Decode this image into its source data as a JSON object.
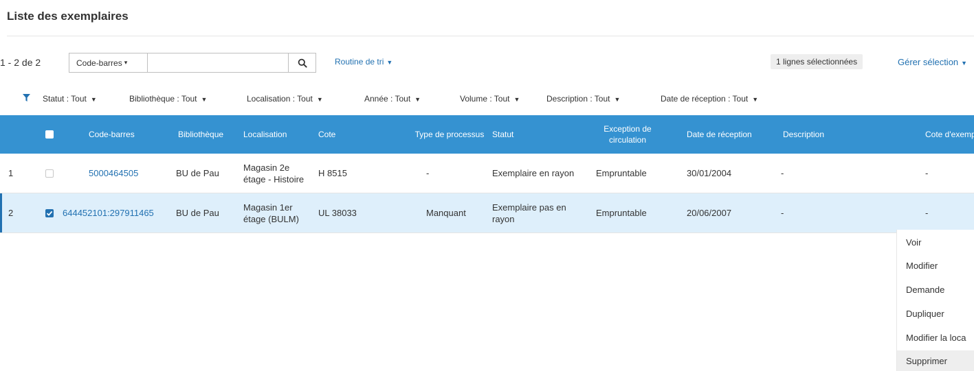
{
  "title": "Liste des exemplaires",
  "toolbar": {
    "count": "1 - 2 de 2",
    "search_type": "Code-barres",
    "search_value": "",
    "sort_label": "Routine de tri",
    "selected_count": "1 lignes sélectionnées",
    "manage_label": "Gérer sélection"
  },
  "filters": [
    {
      "label": "Statut : Tout"
    },
    {
      "label": "Bibliothèque : Tout"
    },
    {
      "label": "Localisation : Tout"
    },
    {
      "label": "Année : Tout"
    },
    {
      "label": "Volume : Tout"
    },
    {
      "label": "Description : Tout"
    },
    {
      "label": "Date de réception : Tout"
    }
  ],
  "columns": {
    "barcode": "Code-barres",
    "library": "Bibliothèque",
    "location": "Localisation",
    "call_number": "Cote",
    "process_type": "Type de processus",
    "status": "Statut",
    "circulation": "Exception de circulation",
    "received": "Date de réception",
    "description": "Description",
    "item_call": "Cote d'exemplaire"
  },
  "rows": [
    {
      "num": "1",
      "checked": false,
      "barcode": "5000464505",
      "library": "BU de Pau",
      "location": "Magasin 2e étage - Histoire",
      "call_number": "H 8515",
      "process_type": "-",
      "status": "Exemplaire en rayon",
      "circulation": "Empruntable",
      "received": "30/01/2004",
      "description": "-",
      "item_call": "-"
    },
    {
      "num": "2",
      "checked": true,
      "barcode": "644452101:297911465",
      "library": "BU de Pau",
      "location": "Magasin 1er étage (BULM)",
      "call_number": "UL 38033",
      "process_type": "Manquant",
      "status": "Exemplaire pas en rayon",
      "circulation": "Empruntable",
      "received": "20/06/2007",
      "description": "-",
      "item_call": "-"
    }
  ],
  "row_menu": {
    "items": [
      "Voir",
      "Modifier",
      "Demande",
      "Dupliquer",
      "Modifier la loca",
      "Supprimer"
    ],
    "highlighted": "Supprimer"
  },
  "colors": {
    "header_bg": "#3592d1",
    "link": "#2271b1",
    "selected_row_bg": "#deeffb"
  }
}
